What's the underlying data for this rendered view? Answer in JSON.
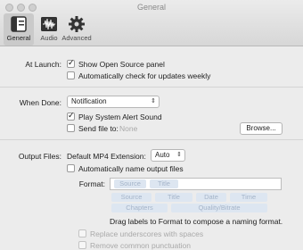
{
  "window": {
    "title": "General"
  },
  "toolbar": [
    {
      "label": "General",
      "icon": "general-icon",
      "selected": true
    },
    {
      "label": "Audio",
      "icon": "audio-icon",
      "selected": false
    },
    {
      "label": "Advanced",
      "icon": "gear-icon",
      "selected": false
    }
  ],
  "at_launch": {
    "label": "At Launch:",
    "show_open_source": {
      "label": "Show Open Source panel",
      "checked": true
    },
    "auto_updates": {
      "label": "Automatically check for updates weekly",
      "checked": false
    }
  },
  "when_done": {
    "label": "When Done:",
    "action_value": "Notification",
    "play_sound": {
      "label": "Play System Alert Sound",
      "checked": true
    },
    "send_file": {
      "label": "Send file to:",
      "checked": false,
      "target": "None"
    },
    "browse_button": "Browse..."
  },
  "output_files": {
    "label": "Output Files:",
    "mp4_label": "Default MP4 Extension:",
    "mp4_value": "Auto",
    "auto_name": {
      "label": "Automatically name output files",
      "checked": false
    },
    "format_label": "Format:",
    "format_tokens": [
      "Source",
      "Title"
    ],
    "available_tokens_row1": [
      "Source",
      "Title",
      "Date",
      "Time"
    ],
    "available_tokens_row2": [
      "Chapters",
      "Quality/Bitrate"
    ],
    "hint": "Drag labels to Format to compose a naming format.",
    "replace_underscores": {
      "label": "Replace underscores with spaces",
      "checked": false
    },
    "remove_punctuation": {
      "label": "Remove common punctuation",
      "checked": false
    }
  },
  "colors": {
    "token_bg": "#c8d9ee",
    "token_text": "#6d87ab"
  }
}
